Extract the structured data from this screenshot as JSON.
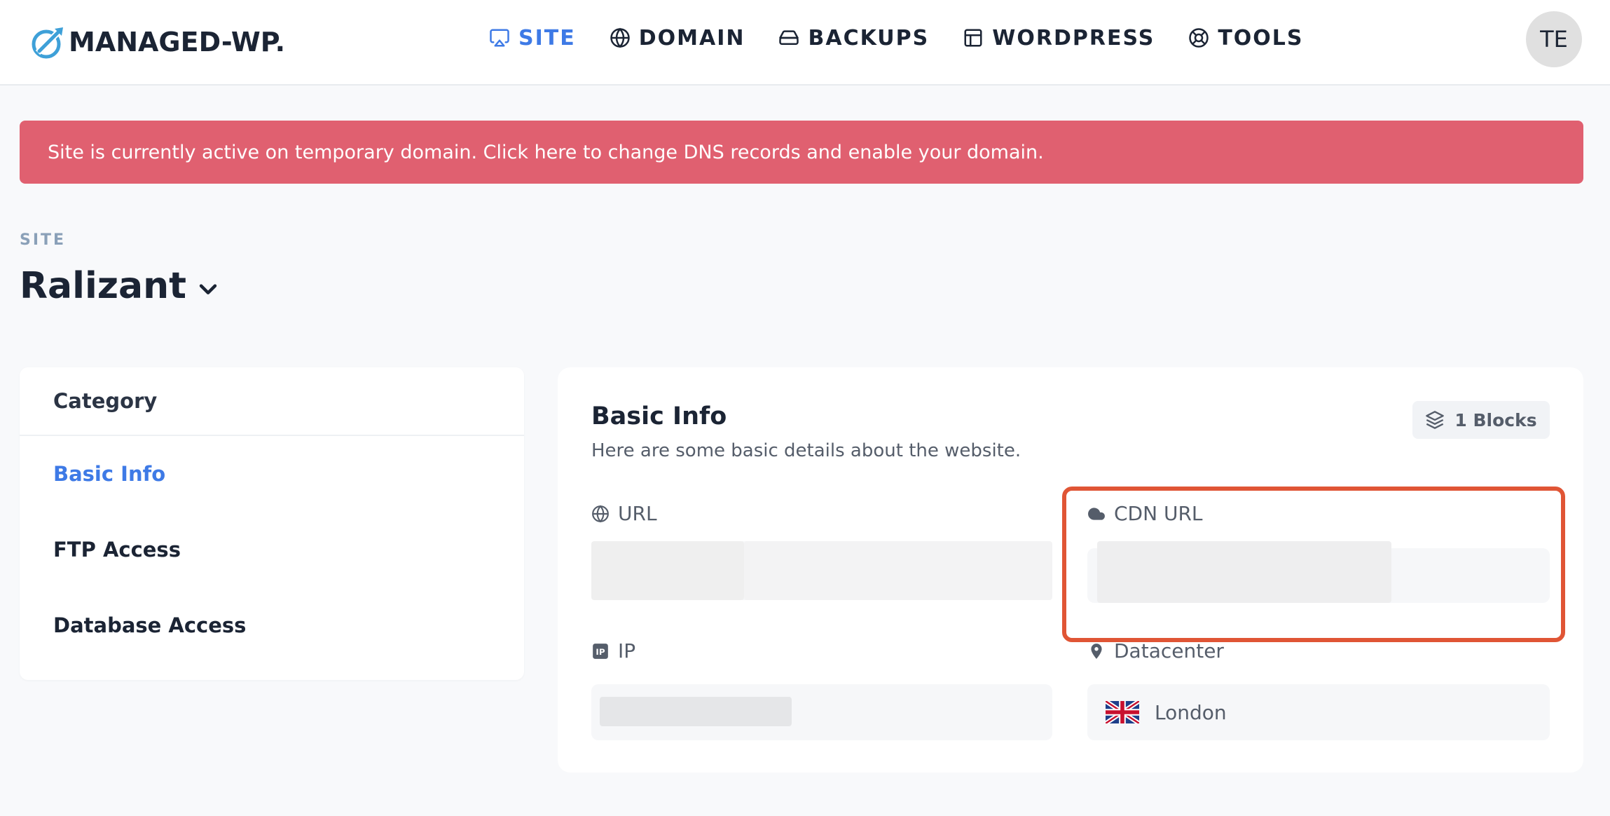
{
  "brand": {
    "name": "MANAGED-WP."
  },
  "nav": {
    "items": [
      {
        "label": "SITE",
        "icon": "monitor-icon",
        "active": true
      },
      {
        "label": "DOMAIN",
        "icon": "globe-icon"
      },
      {
        "label": "BACKUPS",
        "icon": "hard-drive-icon"
      },
      {
        "label": "WORDPRESS",
        "icon": "layout-icon"
      },
      {
        "label": "TOOLS",
        "icon": "lifebuoy-icon"
      }
    ]
  },
  "user": {
    "initials": "TE"
  },
  "alert": {
    "text": "Site is currently active on temporary domain. Click here to change DNS records and enable your domain."
  },
  "site": {
    "eyebrow": "SITE",
    "name": "Ralizant"
  },
  "category": {
    "header": "Category",
    "items": [
      {
        "label": "Basic Info",
        "active": true
      },
      {
        "label": "FTP Access"
      },
      {
        "label": "Database Access"
      }
    ]
  },
  "basic_info": {
    "title": "Basic Info",
    "subtitle": "Here are some basic details about the website.",
    "blocks_label": "1 Blocks",
    "fields": {
      "url": {
        "label": "URL",
        "icon": "globe-icon"
      },
      "cdn_url": {
        "label": "CDN URL",
        "icon": "cloud-icon"
      },
      "ip": {
        "label": "IP",
        "icon": "ip-icon"
      },
      "datacenter": {
        "label": "Datacenter",
        "icon": "map-pin-icon",
        "value": "London",
        "flag": "uk-flag-icon"
      }
    }
  },
  "colors": {
    "accent": "#3e7ae6",
    "alert_bg": "#e06070",
    "highlight": "#e05535",
    "text_dark": "#1b2434",
    "text_muted": "#555d6a"
  }
}
